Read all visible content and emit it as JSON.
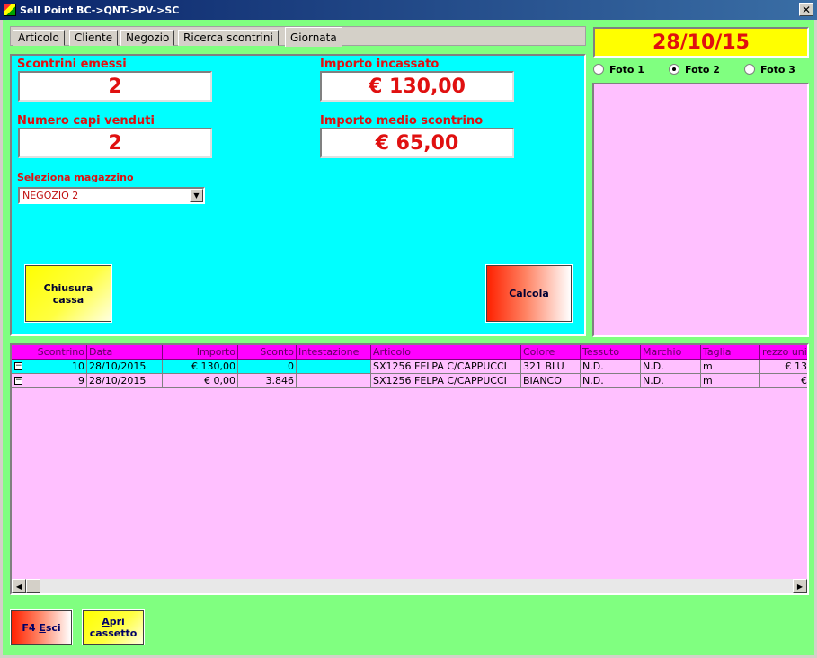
{
  "window": {
    "title": "Sell Point BC->QNT->PV->SC",
    "close_glyph": "✕"
  },
  "tabs": [
    {
      "label": "Articolo"
    },
    {
      "label": "Cliente"
    },
    {
      "label": "Negozio"
    },
    {
      "label": "Ricerca scontrini"
    },
    {
      "label": "Giornata"
    }
  ],
  "summary": {
    "scontrini_label": "Scontrini emessi",
    "scontrini_value": "2",
    "importo_label": "Importo incassato",
    "importo_value": "€ 130,00",
    "capi_label": "Numero capi venduti",
    "capi_value": "2",
    "medio_label": "Importo medio scontrino",
    "medio_value": "€ 65,00",
    "magazzino_label": "Seleziona magazzino",
    "magazzino_value": "NEGOZIO 2"
  },
  "buttons": {
    "chiusura_line1": "Chiusura",
    "chiusura_line2": "cassa",
    "calcola": "Calcola",
    "esci_key": "F4",
    "esci_u": "E",
    "esci_rest": "sci",
    "apri_u": "A",
    "apri_rest": "pri",
    "apri_line2": "cassetto"
  },
  "date": "28/10/15",
  "photos": [
    {
      "label": "Foto 1",
      "checked": false
    },
    {
      "label": "Foto 2",
      "checked": true
    },
    {
      "label": "Foto 3",
      "checked": false
    }
  ],
  "grid": {
    "columns": [
      "Scontrino",
      "Data",
      "Importo",
      "Sconto",
      "Intestazione",
      "Articolo",
      "Colore",
      "Tessuto",
      "Marchio",
      "Taglia",
      "rezzo uni"
    ],
    "rows": [
      [
        "10",
        "28/10/2015",
        "€ 130,00",
        "0",
        "",
        "SX1256 FELPA C/CAPPUCCI",
        "321 BLU",
        "N.D.",
        "N.D.",
        "m",
        "€ 13"
      ],
      [
        "9",
        "28/10/2015",
        "€ 0,00",
        "3.846",
        "",
        "SX1256 FELPA C/CAPPUCCI",
        "BIANCO",
        "N.D.",
        "N.D.",
        "m",
        "€"
      ]
    ]
  }
}
